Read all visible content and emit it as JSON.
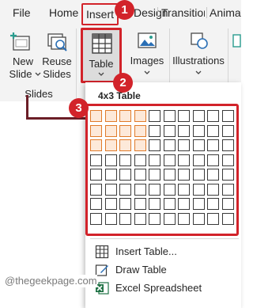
{
  "tabs": {
    "file": "File",
    "home": "Home",
    "insert": "Insert",
    "design": "Design",
    "transitions": "Transitions",
    "animations": "Animations"
  },
  "ribbon": {
    "new_slide": {
      "line1": "New",
      "line2": "Slide"
    },
    "reuse_slides": {
      "line1": "Reuse",
      "line2": "Slides"
    },
    "slides_group": "Slides",
    "table": "Table",
    "images": "Images",
    "illustrations": "Illustrations"
  },
  "dropdown": {
    "title": "4x3 Table",
    "grid": {
      "columns": 10,
      "rows": 8,
      "selected_columns": 4,
      "selected_rows": 3
    },
    "items": [
      {
        "label": "Insert Table...",
        "icon": "insert-table-icon"
      },
      {
        "label": "Draw Table",
        "icon": "draw-table-icon"
      },
      {
        "label": "Excel Spreadsheet",
        "icon": "excel-icon"
      }
    ]
  },
  "callouts": {
    "one": "1",
    "two": "2",
    "three": "3"
  },
  "watermark": "@thegeekpage.com",
  "colors": {
    "callout": "#d2232a",
    "highlight_border": "#d2232a",
    "selected_cell_border": "#e07b2a",
    "ribbon_bg": "#f3f3f3"
  }
}
